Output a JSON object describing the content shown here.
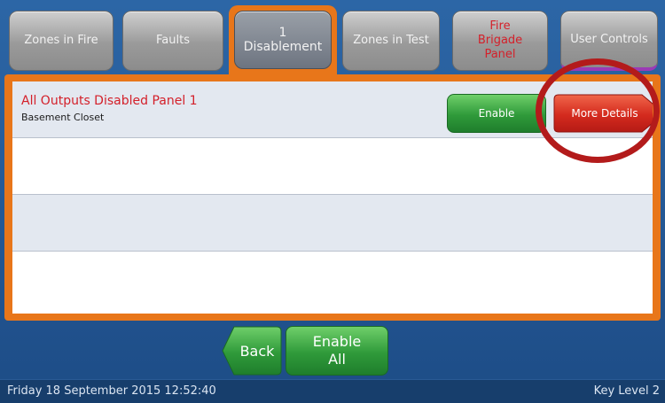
{
  "tabs": {
    "zones_in_fire": "Zones in Fire",
    "faults": "Faults",
    "disablement_count": "1",
    "disablement": "Disablement",
    "zones_in_test": "Zones in Test",
    "fire_brigade": [
      "Fire",
      "Brigade",
      "Panel"
    ],
    "user_controls": "User Controls"
  },
  "list": {
    "items": [
      {
        "title": "All Outputs Disabled Panel 1",
        "location": "Basement Closet",
        "enable_label": "Enable",
        "details_label": "More Details"
      }
    ]
  },
  "bottom": {
    "back_label": "Back",
    "enable_all_line1": "Enable",
    "enable_all_line2": "All"
  },
  "status": {
    "datetime": "Friday 18 September 2015 12:52:40",
    "key_level": "Key Level 2"
  },
  "colors": {
    "accent_orange": "#e8761a",
    "alert_red": "#d4202a",
    "highlight_circle": "#b31b1b",
    "background_blue": "#1f4f86"
  }
}
